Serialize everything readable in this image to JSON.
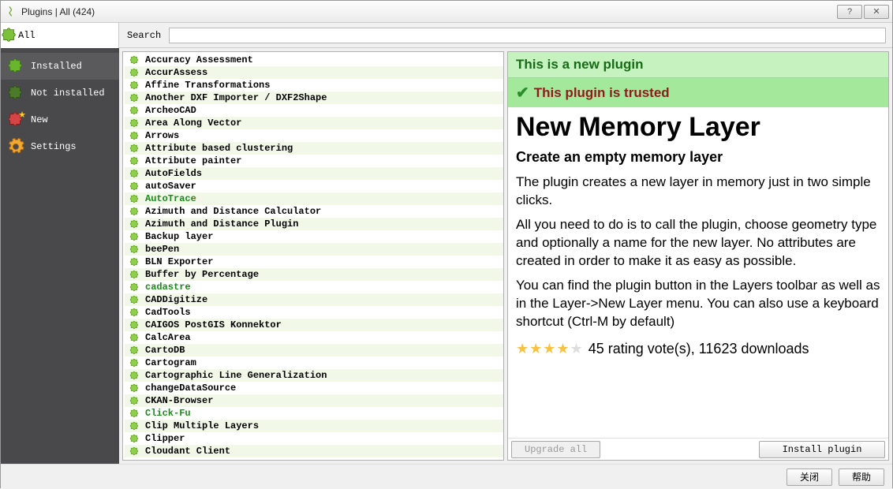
{
  "window": {
    "title": "Plugins | All (424)"
  },
  "sidebar": {
    "top_label": "All",
    "items": [
      {
        "label": "Installed",
        "icon": "puzzle-green"
      },
      {
        "label": "Not installed",
        "icon": "puzzle-dim"
      },
      {
        "label": "New",
        "icon": "puzzle-star"
      },
      {
        "label": "Settings",
        "icon": "gear"
      }
    ]
  },
  "search": {
    "label": "Search",
    "value": ""
  },
  "plugins": [
    {
      "name": "Accuracy Assessment"
    },
    {
      "name": "AccurAssess"
    },
    {
      "name": "Affine Transformations"
    },
    {
      "name": "Another DXF Importer / DXF2Shape"
    },
    {
      "name": "ArcheoCAD"
    },
    {
      "name": "Area Along Vector"
    },
    {
      "name": "Arrows"
    },
    {
      "name": "Attribute based clustering"
    },
    {
      "name": "Attribute painter"
    },
    {
      "name": "AutoFields"
    },
    {
      "name": "autoSaver"
    },
    {
      "name": "AutoTrace",
      "highlight": true
    },
    {
      "name": "Azimuth and Distance Calculator"
    },
    {
      "name": "Azimuth and Distance Plugin"
    },
    {
      "name": "Backup layer"
    },
    {
      "name": "beePen"
    },
    {
      "name": "BLN Exporter"
    },
    {
      "name": "Buffer by Percentage"
    },
    {
      "name": "cadastre",
      "highlight": true
    },
    {
      "name": "CADDigitize"
    },
    {
      "name": "CadTools"
    },
    {
      "name": "CAIGOS PostGIS Konnektor"
    },
    {
      "name": "CalcArea"
    },
    {
      "name": "CartoDB"
    },
    {
      "name": "Cartogram"
    },
    {
      "name": "Cartographic Line Generalization"
    },
    {
      "name": "changeDataSource"
    },
    {
      "name": "CKAN-Browser"
    },
    {
      "name": "Click-Fu",
      "highlight": true
    },
    {
      "name": "Clip Multiple Layers"
    },
    {
      "name": "Clipper"
    },
    {
      "name": "Cloudant Client"
    }
  ],
  "details": {
    "banner_new": "This is a new plugin",
    "banner_trusted": "This plugin is trusted",
    "title": "New Memory Layer",
    "subtitle": "Create an empty memory layer",
    "desc1": "The plugin creates a new layer in memory just in two simple clicks.",
    "desc2": "All you need to do is to call the plugin, choose geometry type and optionally a name for the new layer. No attributes are created in order to make it as easy as possible.",
    "desc3": "You can find the plugin button in the Layers toolbar as well as in the Layer->New Layer menu. You can also use a keyboard shortcut (Ctrl-M by default)",
    "rating_text": "45 rating vote(s), 11623 downloads",
    "stars_full": 4,
    "stars_empty": 1
  },
  "buttons": {
    "upgrade_all": "Upgrade all",
    "install": "Install plugin",
    "close": "关闭",
    "help": "帮助"
  }
}
